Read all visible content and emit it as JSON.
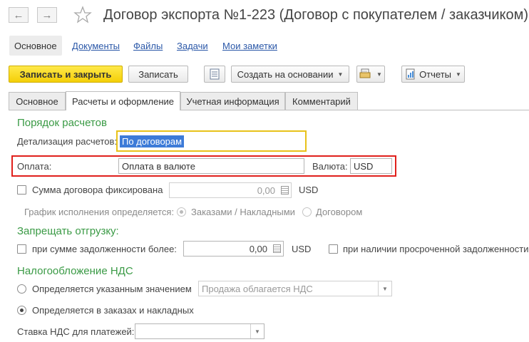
{
  "window": {
    "title": "Договор экспорта №1-223 (Договор с покупателем / заказчиком)",
    "back_icon": "arrow-left-icon",
    "forward_icon": "arrow-right-icon",
    "favorite_icon": "star-icon"
  },
  "sections": {
    "main": "Основное",
    "documents": "Документы",
    "files": "Файлы",
    "tasks": "Задачи",
    "notes": "Мои заметки"
  },
  "toolbar": {
    "save_close": "Записать и закрыть",
    "save": "Записать",
    "create_based": "Создать на основании",
    "reports": "Отчеты"
  },
  "tabs": [
    "Основное",
    "Расчеты и оформление",
    "Учетная информация",
    "Комментарий"
  ],
  "payment_order": {
    "heading": "Порядок расчетов",
    "detail_label": "Детализация расчетов:",
    "detail_value": "По договорам",
    "payment_label": "Оплата:",
    "payment_value": "Оплата в валюте",
    "currency_label": "Валюта:",
    "currency_value": "USD",
    "fixed_sum_label": "Сумма договора фиксирована",
    "fixed_sum_value": "0,00",
    "fixed_sum_currency": "USD",
    "schedule_label": "График исполнения определяется:",
    "schedule_option1": "Заказами / Накладными",
    "schedule_option2": "Договором"
  },
  "shipment_ban": {
    "heading": "Запрещать отгрузку:",
    "debt_label": "при сумме задолженности более:",
    "debt_value": "0,00",
    "debt_currency": "USD",
    "overdue_label": "при наличии просроченной задолженности"
  },
  "vat": {
    "heading": "Налогообложение НДС",
    "option_specified": "Определяется указанным значением",
    "specified_value": "Продажа облагается НДС",
    "option_orders": "Определяется в заказах и накладных",
    "payment_rate_label": "Ставка НДС для платежей:",
    "payment_rate_value": ""
  },
  "colors": {
    "accent_green": "#3a9a45",
    "primary_button": "#f4cf07",
    "highlight_border_red": "#e0201c",
    "focus_border_yellow": "#e8c21a",
    "selection_blue": "#3d7bd8"
  }
}
